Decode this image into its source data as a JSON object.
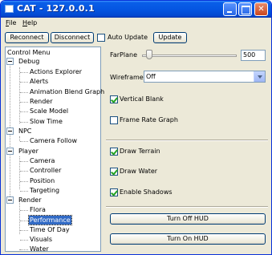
{
  "window": {
    "title": "CAT - 127.0.0.1"
  },
  "menubar": {
    "file": {
      "accel": "F",
      "rest": "ile"
    },
    "help": {
      "accel": "H",
      "rest": "elp"
    }
  },
  "toolbar": {
    "reconnect_label": "Reconnect",
    "disconnect_label": "Disconnect",
    "auto_update_label": "Auto Update",
    "auto_update_checked": false,
    "update_label": "Update"
  },
  "tree": {
    "root": "Control Menu",
    "groups": [
      {
        "label": "Debug",
        "children": [
          "Actions Explorer",
          "Alerts",
          "Animation Blend Graph",
          "Render",
          "Scale Model",
          "Slow Time"
        ]
      },
      {
        "label": "NPC",
        "children": [
          "Camera Follow"
        ]
      },
      {
        "label": "Player",
        "children": [
          "Camera",
          "Controller",
          "Position",
          "Targeting"
        ]
      },
      {
        "label": "Render",
        "children": [
          "Flora",
          "Performance",
          "Time Of Day",
          "Visuals",
          "Water"
        ]
      }
    ],
    "selected": "Performance"
  },
  "panel": {
    "farplane_label": "FarPlane",
    "farplane_value": "500",
    "wireframe_label": "Wireframe",
    "wireframe_value": "Off",
    "vertical_blank_label": "Vertical Blank",
    "vertical_blank_checked": true,
    "frame_rate_graph_label": "Frame Rate Graph",
    "frame_rate_graph_checked": false,
    "draw_terrain_label": "Draw Terrain",
    "draw_terrain_checked": true,
    "draw_water_label": "Draw Water",
    "draw_water_checked": true,
    "enable_shadows_label": "Enable Shadows",
    "enable_shadows_checked": true,
    "turn_off_hud_label": "Turn Off HUD",
    "turn_on_hud_label": "Turn On HUD"
  },
  "colors": {
    "titlebar": "#0556e2",
    "selection": "#316ac5",
    "window_bg": "#ece9d8",
    "check": "#21a121"
  }
}
